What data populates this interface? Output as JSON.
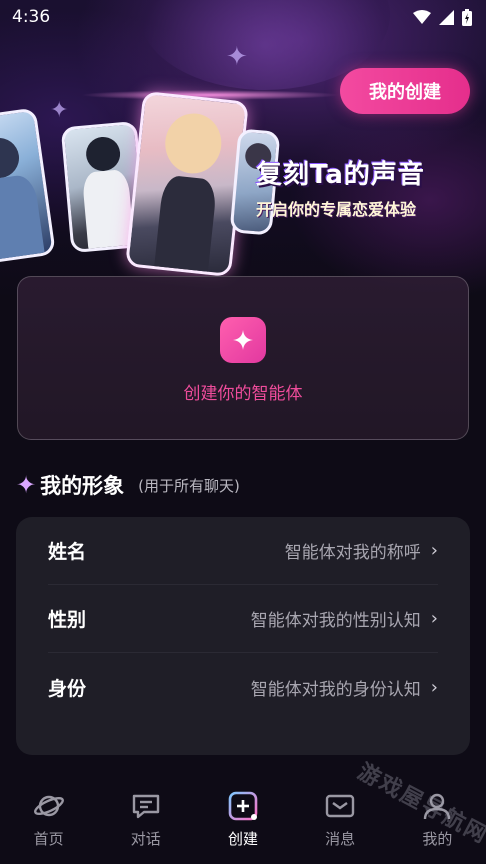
{
  "status_bar": {
    "time": "4:36"
  },
  "header": {
    "my_create_button": "我的创建"
  },
  "hero": {
    "title": "复刻Ta的声音",
    "subtitle": "开启你的专属恋爱体验"
  },
  "create_panel": {
    "label": "创建你的智能体"
  },
  "section": {
    "title": "我的形象",
    "note": "(用于所有聊天)"
  },
  "profile_rows": [
    {
      "label": "姓名",
      "value": "智能体对我的称呼"
    },
    {
      "label": "性别",
      "value": "智能体对我的性别认知"
    },
    {
      "label": "身份",
      "value": "智能体对我的身份认知"
    }
  ],
  "tabs": [
    {
      "label": "首页",
      "icon": "planet-icon"
    },
    {
      "label": "对话",
      "icon": "chat-icon"
    },
    {
      "label": "创建",
      "icon": "create-icon"
    },
    {
      "label": "消息",
      "icon": "mail-icon"
    },
    {
      "label": "我的",
      "icon": "person-icon"
    }
  ],
  "active_tab": "创建",
  "watermark": "游戏屋导航网",
  "colors": {
    "accent": "#ef4c9b",
    "background": "#0e0b16",
    "card": "#1f1e27"
  }
}
